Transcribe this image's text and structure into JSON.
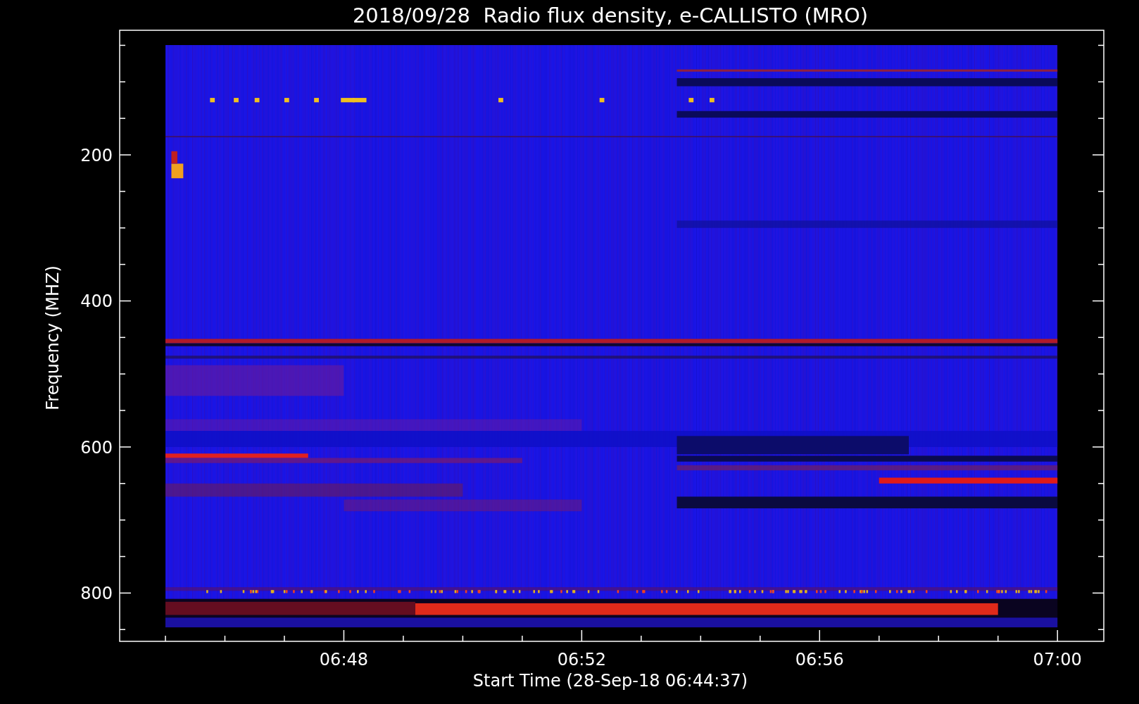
{
  "title": "2018/09/28  Radio flux density, e-CALLISTO (MRO)",
  "plot": {
    "ylabel": "Frequency (MHZ)",
    "xlabel": "Start Time (28-Sep-18 06:44:37)",
    "yticks": [
      "200",
      "400",
      "600",
      "800"
    ],
    "xticks": [
      "06:48",
      "06:52",
      "06:56",
      "07:00"
    ]
  }
}
